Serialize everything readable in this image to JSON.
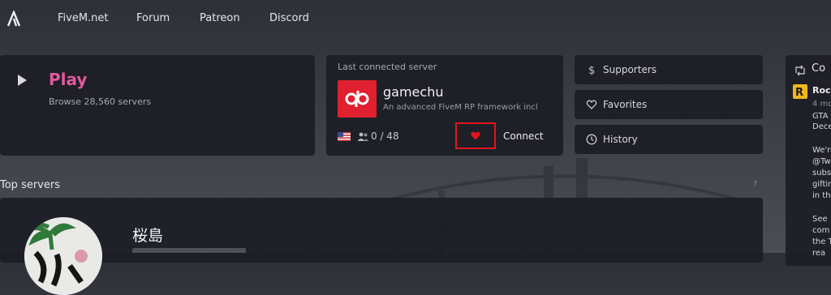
{
  "nav": {
    "logo_icon": "fivem-logo-icon",
    "links": [
      "FiveM.net",
      "Forum",
      "Patreon",
      "Discord"
    ]
  },
  "play": {
    "title": "Play",
    "subtitle": "Browse 28,560 servers",
    "icon": "play-icon",
    "title_color": "#e05a9e"
  },
  "last_server": {
    "label": "Last connected server",
    "name": "gamechu",
    "description": "An advanced FiveM RP framework incl",
    "players": "0 / 48",
    "connect_label": "Connect",
    "logo_color": "#e0202e",
    "favorite_color": "#e2141e"
  },
  "side_buttons": [
    {
      "label": "Supporters",
      "icon": "dollar-icon"
    },
    {
      "label": "Favorites",
      "icon": "heart-outline-icon"
    },
    {
      "label": "History",
      "icon": "clock-icon"
    }
  ],
  "right_panel": {
    "title": "Co",
    "author": "Rock",
    "lines": [
      "4 mo",
      "GTA",
      "Dece",
      "We're",
      "@Tw",
      "subs",
      "giftin",
      "in th",
      "See",
      "com",
      "the T",
      "rea"
    ]
  },
  "top_servers": {
    "label": "Top servers",
    "help": "?",
    "featured_name": "桜島"
  }
}
